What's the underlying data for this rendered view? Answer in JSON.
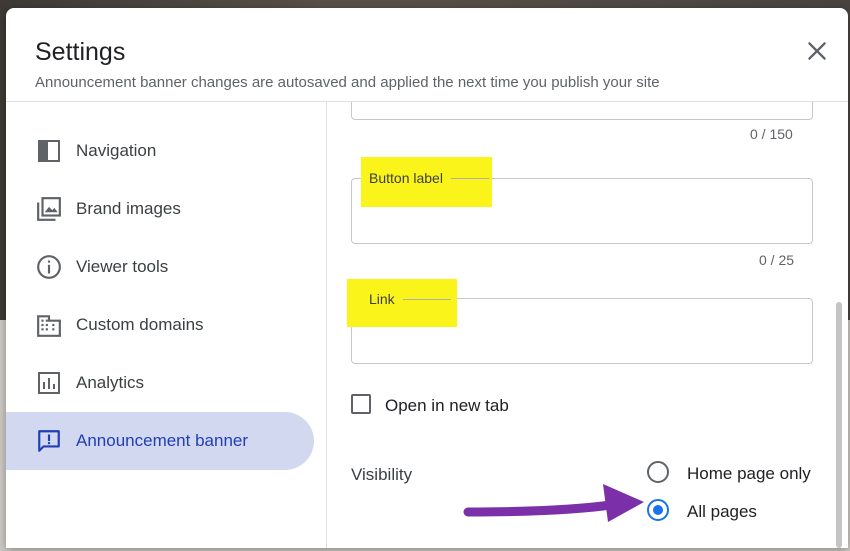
{
  "dialog": {
    "title": "Settings",
    "subtitle": "Announcement banner changes are autosaved and applied the next time you publish your site",
    "close_icon": "close-icon"
  },
  "sidebar": {
    "items": [
      {
        "label": "Navigation",
        "icon": "navigation-icon",
        "active": false
      },
      {
        "label": "Brand images",
        "icon": "brand-images-icon",
        "active": false
      },
      {
        "label": "Viewer tools",
        "icon": "info-icon",
        "active": false
      },
      {
        "label": "Custom domains",
        "icon": "domain-icon",
        "active": false
      },
      {
        "label": "Analytics",
        "icon": "analytics-icon",
        "active": false
      },
      {
        "label": "Announcement banner",
        "icon": "announcement-icon",
        "active": true
      }
    ]
  },
  "form": {
    "message_counter": "0 / 150",
    "button_label": {
      "label": "Button label",
      "value": "",
      "counter": "0 / 25"
    },
    "link": {
      "label": "Link",
      "value": ""
    },
    "open_in_new_tab": {
      "label": "Open in new tab",
      "checked": false
    },
    "visibility": {
      "label": "Visibility",
      "options": [
        {
          "label": "Home page only",
          "checked": false
        },
        {
          "label": "All pages",
          "checked": true
        }
      ]
    }
  },
  "colors": {
    "accent": "#1a73e8",
    "active_nav_bg": "#d3d8f1",
    "highlight": "#fbf41a",
    "annotation_arrow": "#7b2fa8"
  }
}
